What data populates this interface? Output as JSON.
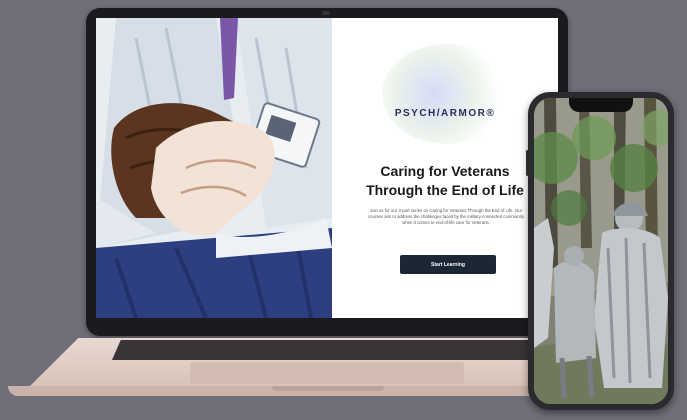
{
  "website": {
    "logo_text": "PSYCH/ARMOR®",
    "headline_line1": "Caring for Veterans",
    "headline_line2": "Through the End of Life",
    "description": "Join us for our 3-part series on Caring for Veterans Through the End of Life. Our courses aim to address the challenges faced by the military-connected community when it comes to end-of-life care for Veterans.",
    "cta_label": "Start Learning"
  },
  "colors": {
    "background": "#6f6f79",
    "cta_background": "#1c2736",
    "logo": "#2a2f5a"
  },
  "icons": {
    "hero": "illustration-holding-hands",
    "phone": "illustration-soldier-memorial"
  }
}
